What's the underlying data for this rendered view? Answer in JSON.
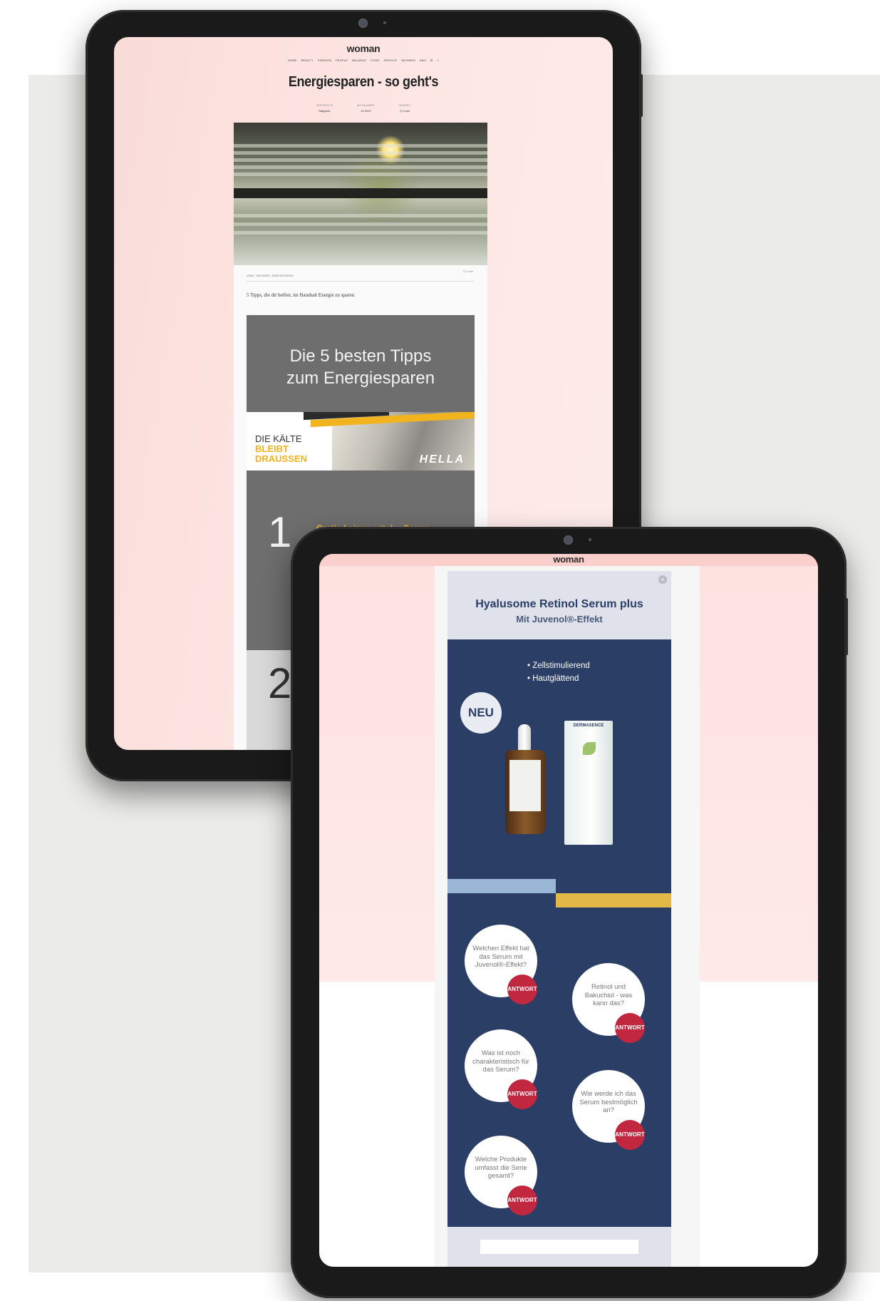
{
  "tablet_top": {
    "site_logo": "woman",
    "nav_items": [
      "HOME",
      "BEAUTY",
      "FASHION",
      "PEOPLE",
      "BALANCE",
      "FOOD",
      "SERVICE",
      "WOHNEN",
      "ABO",
      "☰",
      "⌕"
    ],
    "article_title": "Energiesparen - so geht's",
    "meta": [
      {
        "label": "GEPOSTET IN",
        "value": "Ratgeber"
      },
      {
        "label": "AKTUALISIERT",
        "value": "10.2022"
      },
      {
        "label": "LESEZEIT",
        "value": "◷ 3 min"
      }
    ],
    "readtime": "◷ 3 min",
    "breadcrumb": "HOME › RATGEBER › ENERGIESPAREN",
    "lead_text": "5 Tipps, die dir helfen, im Haushalt Energie zu sparen.",
    "ad": {
      "title_line1": "Die 5 besten Tipps",
      "title_line2": "zum Energiesparen",
      "banner_line1": "DIE KÄLTE",
      "banner_line2": "BLEIBT",
      "banner_line3": "DRAUSSEN",
      "banner_brand": "HELLA",
      "tip1_number": "1",
      "tip1_title": "Gratis heizen mit der Sonne",
      "tip2_number": "2"
    }
  },
  "tablet_bottom": {
    "site_logo": "woman",
    "ad": {
      "close_glyph": "×",
      "title": "Hyalusome Retinol Serum plus",
      "subtitle": "Mit Juvenol®-Effekt",
      "bullets": [
        "• Zellstimulierend",
        "• Hautglättend"
      ],
      "badge": "NEU",
      "box_brand": "DERMASENCE",
      "questions": [
        {
          "text": "Welchen Effekt hat das Serum mit Juvenol®-Effekt?",
          "button": "ANTWORT"
        },
        {
          "text": "Retinol und Bakuchiol - was kann das?",
          "button": "ANTWORT"
        },
        {
          "text": "Was ist noch charakteristisch für das Serum?",
          "button": "ANTWORT"
        },
        {
          "text": "Wie werde ich das Serum bestmöglich an?",
          "button": "ANTWORT"
        },
        {
          "text": "Welche Produkte umfasst die Serie gesamt?",
          "button": "ANTWORT"
        }
      ]
    }
  },
  "colors": {
    "page_pink": "#fde5e3",
    "ad_navy": "#2b3e66",
    "ad_yellow": "#f2b41e",
    "antwort_red": "#c1283f",
    "band_blue": "#9bb7d8",
    "band_gold": "#e2b949"
  }
}
